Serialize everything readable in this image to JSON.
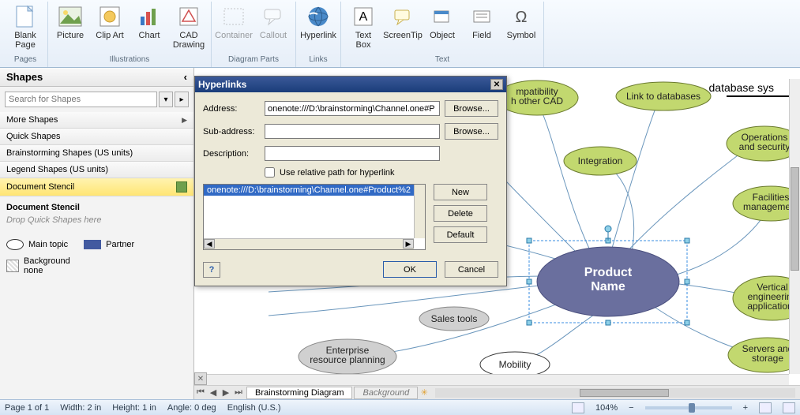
{
  "ribbon": {
    "groups": [
      {
        "label": "Pages",
        "buttons": [
          {
            "label": "Blank\nPage",
            "icon": "blank-page"
          }
        ]
      },
      {
        "label": "Illustrations",
        "buttons": [
          {
            "label": "Picture",
            "icon": "picture"
          },
          {
            "label": "Clip\nArt",
            "icon": "clip-art"
          },
          {
            "label": "Chart",
            "icon": "chart"
          },
          {
            "label": "CAD\nDrawing",
            "icon": "cad"
          }
        ]
      },
      {
        "label": "Diagram Parts",
        "buttons": [
          {
            "label": "Container",
            "icon": "container",
            "disabled": true
          },
          {
            "label": "Callout",
            "icon": "callout",
            "disabled": true
          }
        ]
      },
      {
        "label": "Links",
        "buttons": [
          {
            "label": "Hyperlink",
            "icon": "hyperlink"
          }
        ]
      },
      {
        "label": "Text",
        "buttons": [
          {
            "label": "Text\nBox",
            "icon": "textbox"
          },
          {
            "label": "ScreenTip",
            "icon": "screentip"
          },
          {
            "label": "Object",
            "icon": "object"
          },
          {
            "label": "Field",
            "icon": "field"
          },
          {
            "label": "Symbol",
            "icon": "symbol"
          }
        ]
      }
    ]
  },
  "shapes_panel": {
    "title": "Shapes",
    "search_placeholder": "Search for Shapes",
    "stencils": [
      {
        "label": "More Shapes",
        "chevron": true
      },
      {
        "label": "Quick Shapes"
      },
      {
        "label": "Brainstorming Shapes (US units)"
      },
      {
        "label": "Legend Shapes (US units)"
      },
      {
        "label": "Document Stencil",
        "active": true,
        "icon": true
      }
    ],
    "doc_stencil": {
      "title": "Document Stencil",
      "hint": "Drop Quick Shapes here",
      "shapes": [
        {
          "label": "Main topic",
          "kind": "ellipse"
        },
        {
          "label": "Partner",
          "kind": "rect"
        },
        {
          "label": "Background\nnone",
          "kind": "square"
        }
      ]
    }
  },
  "dialog": {
    "title": "Hyperlinks",
    "address_label": "Address:",
    "address_value": "onenote:///D:\\brainstorming\\Channel.one#P",
    "subaddress_label": "Sub-address:",
    "subaddress_value": "",
    "description_label": "Description:",
    "description_value": "",
    "browse": "Browse...",
    "relative_label": "Use relative path for hyperlink",
    "relative_checked": false,
    "list_item": "onenote:///D:\\brainstorming\\Channel.one#Product%2",
    "new": "New",
    "delete": "Delete",
    "default": "Default",
    "ok": "OK",
    "cancel": "Cancel"
  },
  "canvas": {
    "title_text": "database sys",
    "nodes": {
      "compat": "mpatibility\nh other CAD",
      "linkdb": "Link to databases",
      "opsec": "Operations\nand security",
      "integration": "Integration",
      "facilities": "Facilities\nmanagement",
      "product": "Product\nName",
      "vertical": "Vertical\nengineering\napplications",
      "enterprise": "Enterprise\nresource planning",
      "mobility": "Mobility",
      "servers": "Servers and\nstorage",
      "sales": "Sales tools"
    }
  },
  "page_tabs": {
    "active": "Brainstorming Diagram",
    "bg": "Background"
  },
  "status": {
    "page": "Page 1 of 1",
    "width": "Width: 2 in",
    "height": "Height: 1 in",
    "angle": "Angle: 0 deg",
    "lang": "English (U.S.)",
    "zoom": "104%"
  }
}
